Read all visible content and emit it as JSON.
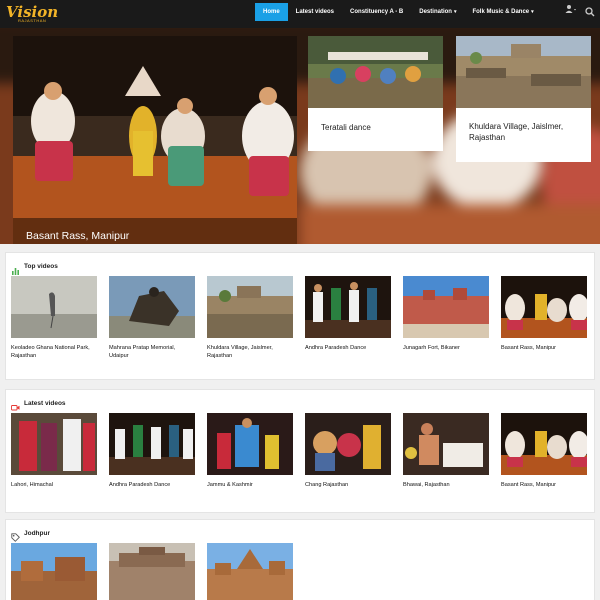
{
  "brand": {
    "name": "Vision",
    "sub": "RAJASTHAN"
  },
  "nav": {
    "items": [
      {
        "label": "Home",
        "active": true,
        "dropdown": false
      },
      {
        "label": "Latest videos",
        "active": false,
        "dropdown": false
      },
      {
        "label": "Constituency A - B",
        "active": false,
        "dropdown": false
      },
      {
        "label": "Destination",
        "active": false,
        "dropdown": true
      },
      {
        "label": "Folk Music & Dance",
        "active": false,
        "dropdown": true
      }
    ],
    "user_icon": "user-icon",
    "search_icon": "search-icon"
  },
  "hero": {
    "main": {
      "title": "Basant Rass, Manipur"
    },
    "cards": [
      {
        "title": "Teratali dance"
      },
      {
        "title": "Khuldara Village, Jaislmer, Rajasthan"
      }
    ]
  },
  "sections": [
    {
      "title": "Top videos",
      "icon": "bar-chart-icon",
      "items": [
        {
          "title": "Keoladeo Ghana National Park, Rajasthan"
        },
        {
          "title": "Mahrana Pratap Memorial, Udaipur"
        },
        {
          "title": "Khuldara Village, Jaislmer, Rajasthan"
        },
        {
          "title": "Andhra Paradesh Dance"
        },
        {
          "title": "Junagarh Fort, Bikaner"
        },
        {
          "title": "Basant Rass, Manipur"
        }
      ]
    },
    {
      "title": "Latest videos",
      "icon": "video-camera-icon",
      "items": [
        {
          "title": "Lahori, Himachal"
        },
        {
          "title": "Andhra Paradesh Dance"
        },
        {
          "title": "Jammu & Kashmir"
        },
        {
          "title": "Chang Rajasthan"
        },
        {
          "title": "Bhawai, Rajasthan"
        },
        {
          "title": "Basant Rass, Manipur"
        }
      ]
    },
    {
      "title": "Jodhpur",
      "icon": "tag-icon",
      "items": [
        {
          "title": ""
        },
        {
          "title": ""
        },
        {
          "title": ""
        }
      ]
    }
  ],
  "colors": {
    "nav_bg": "#1a1a1a",
    "accent": "#1aa0e6",
    "logo": "#f2b428"
  }
}
